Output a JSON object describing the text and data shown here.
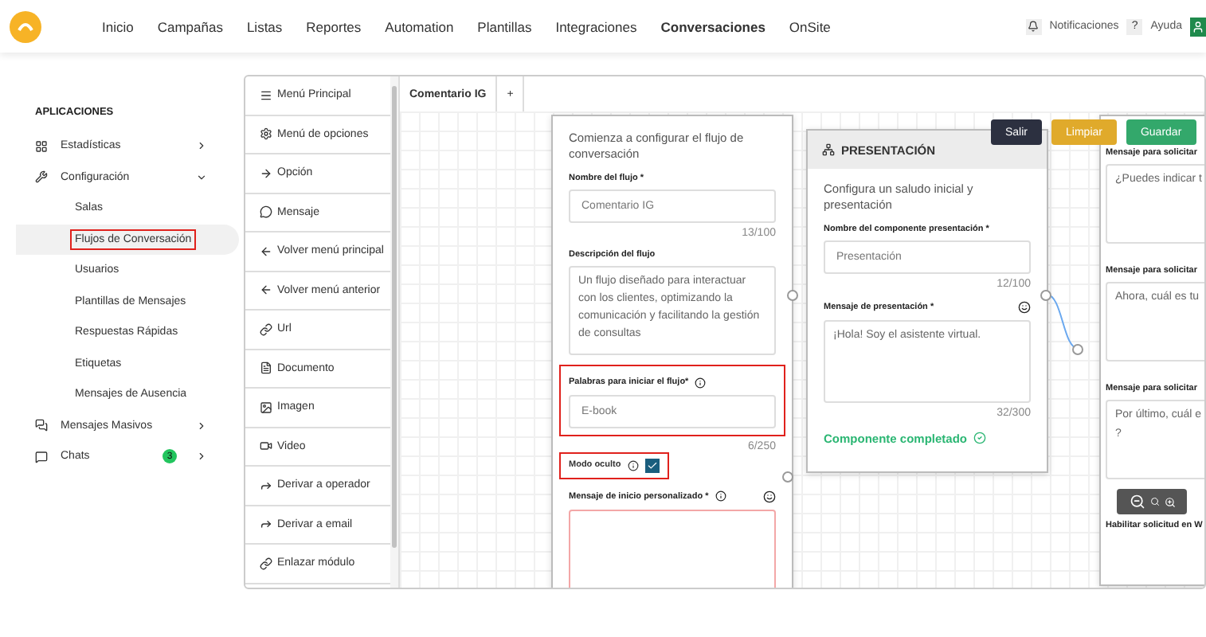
{
  "topnav": {
    "items": [
      {
        "label": "Inicio",
        "selected": false
      },
      {
        "label": "Campañas",
        "selected": false
      },
      {
        "label": "Listas",
        "selected": false
      },
      {
        "label": "Reportes",
        "selected": false
      },
      {
        "label": "Automation",
        "selected": false
      },
      {
        "label": "Plantillas",
        "selected": false
      },
      {
        "label": "Integraciones",
        "selected": false
      },
      {
        "label": "Conversaciones",
        "selected": true
      },
      {
        "label": "OnSite",
        "selected": false
      }
    ],
    "notifications": "Notificaciones",
    "help": "Ayuda",
    "help_icon": "?"
  },
  "sidebar": {
    "section": "APLICACIONES",
    "items": [
      {
        "label": "Estadísticas",
        "expanded": false
      },
      {
        "label": "Configuración",
        "expanded": true,
        "children": [
          {
            "label": "Salas",
            "selected": false,
            "highlighted": false
          },
          {
            "label": "Flujos de Conversación",
            "selected": true,
            "highlighted": true
          },
          {
            "label": "Usuarios",
            "selected": false,
            "highlighted": false
          },
          {
            "label": "Plantillas de Mensajes",
            "selected": false,
            "highlighted": false
          },
          {
            "label": "Respuestas Rápidas",
            "selected": false,
            "highlighted": false
          },
          {
            "label": "Etiquetas",
            "selected": false,
            "highlighted": false
          },
          {
            "label": "Mensajes de Ausencia",
            "selected": false,
            "highlighted": false
          }
        ]
      },
      {
        "label": "Mensajes Masivos",
        "expanded": false
      },
      {
        "label": "Chats",
        "expanded": false,
        "badge": "3"
      }
    ]
  },
  "palette": {
    "items": [
      {
        "label": "Menú Principal"
      },
      {
        "label": "Menú de opciones"
      },
      {
        "label": "Opción"
      },
      {
        "label": "Mensaje"
      },
      {
        "label": "Volver menú principal"
      },
      {
        "label": "Volver menú anterior"
      },
      {
        "label": "Url"
      },
      {
        "label": "Documento"
      },
      {
        "label": "Imagen"
      },
      {
        "label": "Video"
      },
      {
        "label": "Derivar a operador"
      },
      {
        "label": "Derivar a email"
      },
      {
        "label": "Enlazar módulo"
      }
    ]
  },
  "tabs": [
    {
      "label": "Comentario IG",
      "selected": true
    },
    {
      "label": "+",
      "selected": false
    }
  ],
  "actions": [
    {
      "label": "Salir",
      "kind": "dark"
    },
    {
      "label": "Limpiar",
      "kind": "warning"
    },
    {
      "label": "Guardar",
      "kind": "success"
    }
  ],
  "start_node": {
    "intro": "Comienza a configurar el flujo de conversación",
    "name_label": "Nombre del flujo *",
    "name_value": "Comentario IG",
    "name_count": "13/100",
    "description_label": "Descripción del flujo",
    "description_value": "Un flujo diseñado para interactuar con los clientes, optimizando la comunicación y facilitando la gestión de consultas",
    "keywords_label": "Palabras para iniciar el flujo*",
    "keywords_value": "E-book",
    "keywords_count": "6/250",
    "keywords_highlighted": true,
    "hidden_mode_label": "Modo oculto",
    "hidden_mode_checked": true,
    "hidden_mode_highlighted": true,
    "welcome_label": "Mensaje de inicio personalizado *",
    "welcome_invalid": true
  },
  "presentation_node": {
    "title": "PRESENTACIÓN",
    "intro": "Configura un saludo inicial y presentación",
    "name_label": "Nombre del componente presentación *",
    "name_value": "Presentación",
    "name_count": "12/100",
    "message_label": "Mensaje de presentación *",
    "message_value": "¡Hola! Soy el asistente virtual.",
    "message_count": "32/300",
    "status": "Componente completado",
    "completed": true
  },
  "data_node": {
    "fields": [
      {
        "label": "Mensaje para solicitar",
        "value": "¿Puedes indicar t"
      },
      {
        "label": "Mensaje para solicitar",
        "value": "Ahora, cuál es tu"
      },
      {
        "label": "Mensaje para solicitar",
        "value": "Por último, cuál e\n?"
      }
    ],
    "footer_label": "Habilitar solicitud en W"
  }
}
